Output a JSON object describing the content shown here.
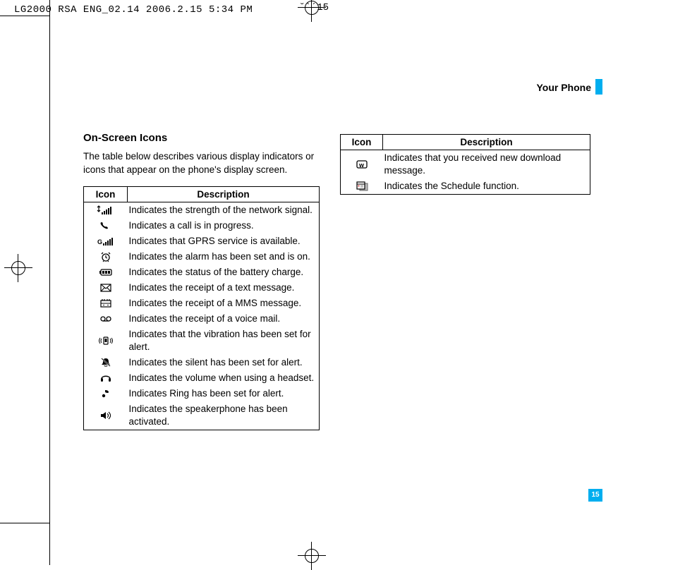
{
  "meta_header": "LG2000 RSA ENG_02.14  2006.2.15 5:34 PM",
  "page_arrow": "˘`´15",
  "section_label": "Your Phone",
  "heading": "On-Screen Icons",
  "intro": "The table below describes various display indicators or icons that appear on the phone's display screen.",
  "th_icon": "Icon",
  "th_desc": "Description",
  "left_rows": [
    {
      "desc": "Indicates the strength of the network signal."
    },
    {
      "desc": "Indicates a call is in progress."
    },
    {
      "desc": "Indicates that GPRS service is available."
    },
    {
      "desc": "Indicates the alarm has been set and is on."
    },
    {
      "desc": "Indicates the status of the battery charge."
    },
    {
      "desc": "Indicates the receipt of a text message."
    },
    {
      "desc": "Indicates the receipt of a MMS message."
    },
    {
      "desc": "Indicates the receipt of a voice mail."
    },
    {
      "desc": "Indicates that the vibration has been set for alert."
    },
    {
      "desc": "Indicates the silent has been set for alert."
    },
    {
      "desc": "Indicates the volume when using a headset."
    },
    {
      "desc": "Indicates Ring has been set for alert."
    },
    {
      "desc": "Indicates the speakerphone has been activated."
    }
  ],
  "right_rows": [
    {
      "desc": "Indicates that you received new download message."
    },
    {
      "desc": "Indicates the Schedule function."
    }
  ],
  "page_number": "15"
}
